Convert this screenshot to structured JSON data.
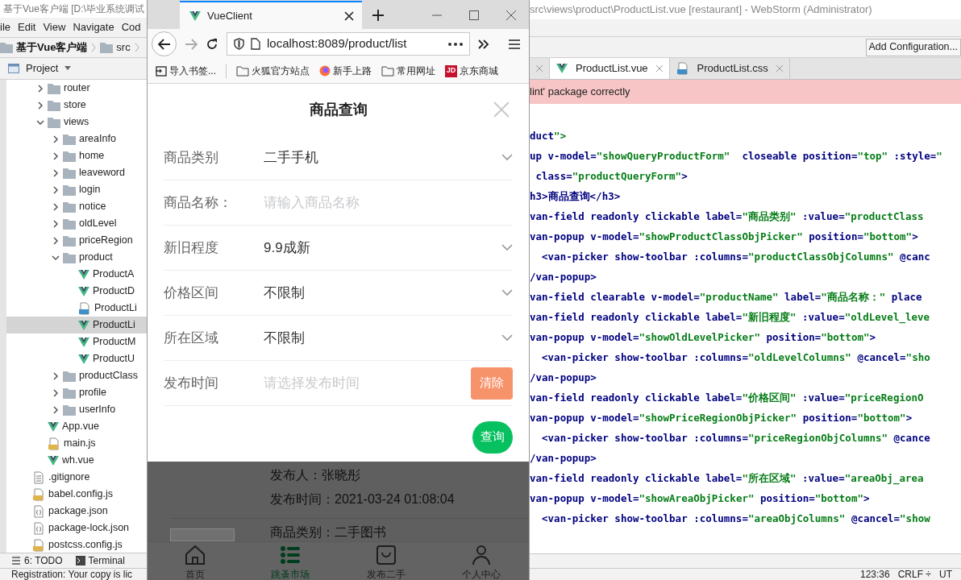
{
  "ide_left": {
    "title": "基于Vue客户端 [D:\\毕业系统调试",
    "menu": [
      "ile",
      "Edit",
      "View",
      "Navigate",
      "Cod"
    ],
    "breadcrumb": [
      "基于Vue客户端",
      "src"
    ],
    "panel_title": "Project",
    "tree": [
      {
        "label": "router",
        "kind": "folder",
        "expanded": false,
        "selected": false
      },
      {
        "label": "store",
        "kind": "folder",
        "expanded": false,
        "selected": false
      },
      {
        "label": "views",
        "kind": "folder",
        "expanded": true,
        "selected": false,
        "children": [
          {
            "label": "areaInfo",
            "kind": "folder",
            "expanded": false,
            "selected": false
          },
          {
            "label": "home",
            "kind": "folder",
            "expanded": false,
            "selected": false
          },
          {
            "label": "leaveword",
            "kind": "folder",
            "expanded": false,
            "selected": false
          },
          {
            "label": "login",
            "kind": "folder",
            "expanded": false,
            "selected": false
          },
          {
            "label": "notice",
            "kind": "folder",
            "expanded": false,
            "selected": false
          },
          {
            "label": "oldLevel",
            "kind": "folder",
            "expanded": false,
            "selected": false
          },
          {
            "label": "priceRegion",
            "kind": "folder",
            "expanded": false,
            "selected": false
          },
          {
            "label": "product",
            "kind": "folder",
            "expanded": true,
            "selected": false,
            "children": [
              {
                "label": "ProductA",
                "kind": "vue",
                "selected": false
              },
              {
                "label": "ProductD",
                "kind": "vue",
                "selected": false
              },
              {
                "label": "ProductLi",
                "kind": "css",
                "selected": false
              },
              {
                "label": "ProductLi",
                "kind": "vue",
                "selected": true
              },
              {
                "label": "ProductM",
                "kind": "vue",
                "selected": false
              },
              {
                "label": "ProductU",
                "kind": "vue",
                "selected": false
              }
            ]
          },
          {
            "label": "productClass",
            "kind": "folder",
            "expanded": false,
            "selected": false
          },
          {
            "label": "profile",
            "kind": "folder",
            "expanded": false,
            "selected": false
          },
          {
            "label": "userInfo",
            "kind": "folder",
            "expanded": false,
            "selected": false
          }
        ]
      },
      {
        "label": "App.vue",
        "kind": "vue",
        "selected": false
      },
      {
        "label": "main.js",
        "kind": "js",
        "selected": false
      },
      {
        "label": "wh.vue",
        "kind": "vue",
        "selected": false
      }
    ],
    "root_files": [
      {
        "label": ".gitignore",
        "kind": "text",
        "selected": false
      },
      {
        "label": "babel.config.js",
        "kind": "js",
        "selected": false
      },
      {
        "label": "package.json",
        "kind": "json",
        "selected": false
      },
      {
        "label": "package-lock.json",
        "kind": "json",
        "selected": false
      },
      {
        "label": "postcss.config.js",
        "kind": "js",
        "selected": false
      }
    ],
    "tool_buttons": [
      {
        "label": "6: TODO",
        "kind": "todo"
      },
      {
        "label": "Terminal",
        "kind": "terminal"
      }
    ],
    "status": "Registration: Your copy is lic"
  },
  "browser": {
    "tab_title": "VueClient",
    "url": "localhost:8089/product/list",
    "bookmarks": [
      {
        "label": "导入书签...",
        "kind": "import"
      },
      {
        "label": "火狐官方站点",
        "kind": "folder"
      },
      {
        "label": "新手上路",
        "kind": "firefox"
      },
      {
        "label": "常用网址",
        "kind": "folder"
      },
      {
        "label": "京东商城",
        "kind": "jd",
        "icon_text": "JD"
      }
    ],
    "form": {
      "title": "商品查询",
      "fields": [
        {
          "kind": "select",
          "label": "商品类别",
          "value": "二手手机"
        },
        {
          "kind": "input",
          "label": "商品名称：",
          "placeholder": "请输入商品名称"
        },
        {
          "kind": "select",
          "label": "新旧程度",
          "value": "9.9成新"
        },
        {
          "kind": "select",
          "label": "价格区间",
          "value": "不限制"
        },
        {
          "kind": "select",
          "label": "所在区域",
          "value": "不限制"
        },
        {
          "kind": "date",
          "label": "发布时间",
          "placeholder": "请选择发布时间",
          "button": "清除"
        }
      ],
      "submit": "查询"
    },
    "list": {
      "lines": [
        "发布人：张晓彤",
        "发布时间：2021-03-24 01:08:04"
      ],
      "next_line": "商品类别：二手图书"
    },
    "tabbar": [
      {
        "label": "首页",
        "kind": "home",
        "selected": false
      },
      {
        "label": "跳蚤市场",
        "kind": "list",
        "selected": true
      },
      {
        "label": "发布二手",
        "kind": "bag",
        "selected": false
      },
      {
        "label": "个人中心",
        "kind": "person",
        "selected": false
      }
    ]
  },
  "ide_right": {
    "title": "src\\views\\product\\ProductList.vue [restaurant] - WebStorm (Administrator)",
    "run_config": "Add Configuration...",
    "tabs": [
      {
        "selected": false
      },
      {
        "label": "ProductList.vue",
        "kind": "vue",
        "selected": true
      },
      {
        "label": "ProductList.css",
        "kind": "css",
        "selected": false
      }
    ],
    "banner": "lint' package correctly",
    "code": [
      "duct\">",
      "up v-model=\"showQueryProductForm\"  closeable position=\"top\" :style=\"",
      " class=\"productQueryForm\">",
      "h3>商品查询</h3>",
      "van-field readonly clickable label=\"商品类别\" :value=\"productClass",
      "van-popup v-model=\"showProductClassObjPicker\" position=\"bottom\">",
      "  <van-picker show-toolbar :columns=\"productClassObjColumns\" @canc",
      "/van-popup>",
      "van-field clearable v-model=\"productName\" label=\"商品名称：\" place",
      "van-field readonly clickable label=\"新旧程度\" :value=\"oldLevel_leve",
      "van-popup v-model=\"showOldLevelPicker\" position=\"bottom\">",
      "  <van-picker show-toolbar :columns=\"oldLevelColumns\" @cancel=\"sho",
      "/van-popup>",
      "van-field readonly clickable label=\"价格区间\" :value=\"priceRegionO",
      "van-popup v-model=\"showPriceRegionObjPicker\" position=\"bottom\">",
      "  <van-picker show-toolbar :columns=\"priceRegionObjColumns\" @cance",
      "/van-popup>",
      "van-field readonly clickable label=\"所在区域\" :value=\"areaObj_area",
      "van-popup v-model=\"showAreaObjPicker\" position=\"bottom\">",
      "  <van-picker show-toolbar :columns=\"areaObjColumns\" @cancel=\"show"
    ],
    "status": [
      "123:36",
      "CRLF ÷",
      "UT"
    ]
  }
}
